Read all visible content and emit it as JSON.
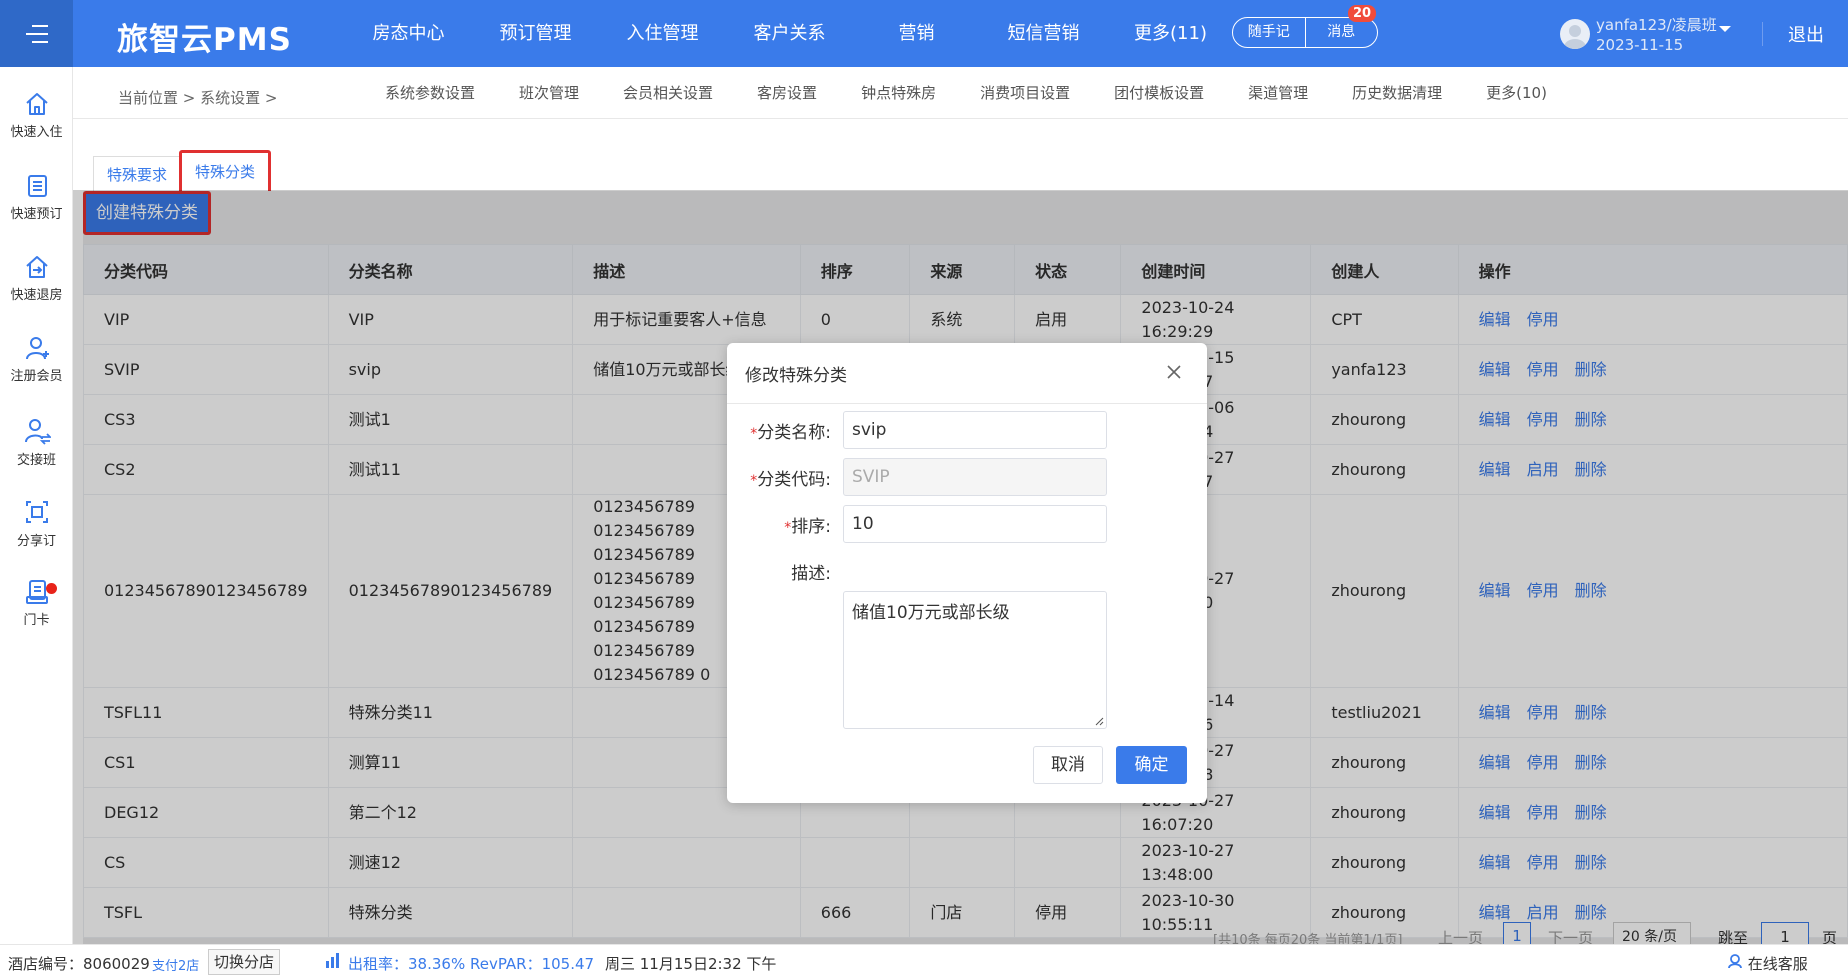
{
  "header": {
    "logo": "旅智云PMS",
    "nav": [
      "房态中心",
      "预订管理",
      "入住管理",
      "客户关系",
      "营销",
      "短信营销",
      "更多(11)"
    ],
    "notes_label": "随手记",
    "messages_label": "消息",
    "message_count": "20",
    "user_name": "yanfa123/凌晨班",
    "user_date": "2023-11-15",
    "logout": "退出"
  },
  "sidebar": {
    "items": [
      "快速入住",
      "快速预订",
      "快速退房",
      "注册会员",
      "交接班",
      "分享订",
      "门卡"
    ]
  },
  "subnav": {
    "breadcrumb": "当前位置 > 系统设置 >",
    "tabs": [
      "系统参数设置",
      "班次管理",
      "会员相关设置",
      "客房设置",
      "钟点特殊房",
      "消费项目设置",
      "团付模板设置",
      "渠道管理",
      "历史数据清理",
      "更多(10)"
    ]
  },
  "page_tabs": [
    "特殊要求",
    "特殊分类"
  ],
  "create_button": "创建特殊分类",
  "table": {
    "headers": [
      "分类代码",
      "分类名称",
      "描述",
      "排序",
      "来源",
      "状态",
      "创建时间",
      "创建人",
      "操作"
    ],
    "rows": [
      {
        "code": "VIP",
        "name": "VIP",
        "desc": "用于标记重要客人+信息",
        "sort": "0",
        "source": "系统",
        "status": "启用",
        "time": "2023-10-24 16:29:29",
        "creator": "CPT",
        "ops": [
          "编辑",
          "停用"
        ]
      },
      {
        "code": "SVIP",
        "name": "svip",
        "desc": "储值10万元或部长级",
        "sort": "",
        "source": "",
        "status": "",
        "time": "2023-11-15 14:29:37",
        "creator": "yanfa123",
        "ops": [
          "编辑",
          "停用",
          "删除"
        ]
      },
      {
        "code": "CS3",
        "name": "测试1",
        "desc": "",
        "sort": "",
        "source": "",
        "status": "",
        "time": "2023-11-06 10:08:34",
        "creator": "zhourong",
        "ops": [
          "编辑",
          "停用",
          "删除"
        ]
      },
      {
        "code": "CS2",
        "name": "测试11",
        "desc": "",
        "sort": "",
        "source": "",
        "status": "",
        "time": "2023-10-27 13:54:57",
        "creator": "zhourong",
        "ops": [
          "编辑",
          "启用",
          "删除"
        ]
      },
      {
        "code": "01234567890123456789",
        "name": "01234567890123456789",
        "desc": "0123456789 0123456789 0123456789 0123456789 0123456789 0123456789 0123456789 0123456789 0",
        "sort": "",
        "source": "",
        "status": "",
        "time": "2023-10-27 11:41:50",
        "creator": "zhourong",
        "ops": [
          "编辑",
          "停用",
          "删除"
        ]
      },
      {
        "code": "TSFL11",
        "name": "特殊分类11",
        "desc": "",
        "sort": "",
        "source": "",
        "status": "",
        "time": "2023-11-14 10:51:16",
        "creator": "testliu2021",
        "ops": [
          "编辑",
          "停用",
          "删除"
        ]
      },
      {
        "code": "CS1",
        "name": "测算11",
        "desc": "",
        "sort": "",
        "source": "",
        "status": "",
        "time": "2023-10-27 13:47:48",
        "creator": "zhourong",
        "ops": [
          "编辑",
          "停用",
          "删除"
        ]
      },
      {
        "code": "DEG12",
        "name": "第二个12",
        "desc": "",
        "sort": "",
        "source": "",
        "status": "",
        "time": "2023-10-27 16:07:20",
        "creator": "zhourong",
        "ops": [
          "编辑",
          "停用",
          "删除"
        ]
      },
      {
        "code": "CS",
        "name": "测速12",
        "desc": "",
        "sort": "",
        "source": "",
        "status": "",
        "time": "2023-10-27 13:48:00",
        "creator": "zhourong",
        "ops": [
          "编辑",
          "停用",
          "删除"
        ]
      },
      {
        "code": "TSFL",
        "name": "特殊分类",
        "desc": "",
        "sort": "666",
        "source": "门店",
        "status": "停用",
        "time": "2023-10-30 10:55:11",
        "creator": "zhourong",
        "ops": [
          "编辑",
          "启用",
          "删除"
        ]
      }
    ]
  },
  "pager": {
    "info": "[共10条 每页20条 当前第1/1页]",
    "prev": "上一页",
    "current": "1",
    "next": "下一页",
    "page_size": "20 条/页",
    "jump_label": "跳至",
    "jump_value": "1",
    "page_suffix": "页"
  },
  "dialog": {
    "title": "修改特殊分类",
    "name_label": "分类名称:",
    "name_value": "svip",
    "code_label": "分类代码:",
    "code_value": "SVIP",
    "sort_label": "排序:",
    "sort_value": "10",
    "desc_label": "描述:",
    "desc_value": "储值10万元或部长级",
    "required_mark": "*",
    "cancel": "取消",
    "confirm": "确定"
  },
  "statusbar": {
    "store_no": "酒店编号：8060029",
    "branch": "支付2店",
    "switch": "切换分店",
    "stats": "出租率：38.36% RevPAR：105.47",
    "datetime": "周三 11月15日2:32 下午",
    "service": "在线客服"
  },
  "colors": {
    "primary": "#3a7bea",
    "highlight": "#e03030",
    "badge": "#f04c3b"
  }
}
